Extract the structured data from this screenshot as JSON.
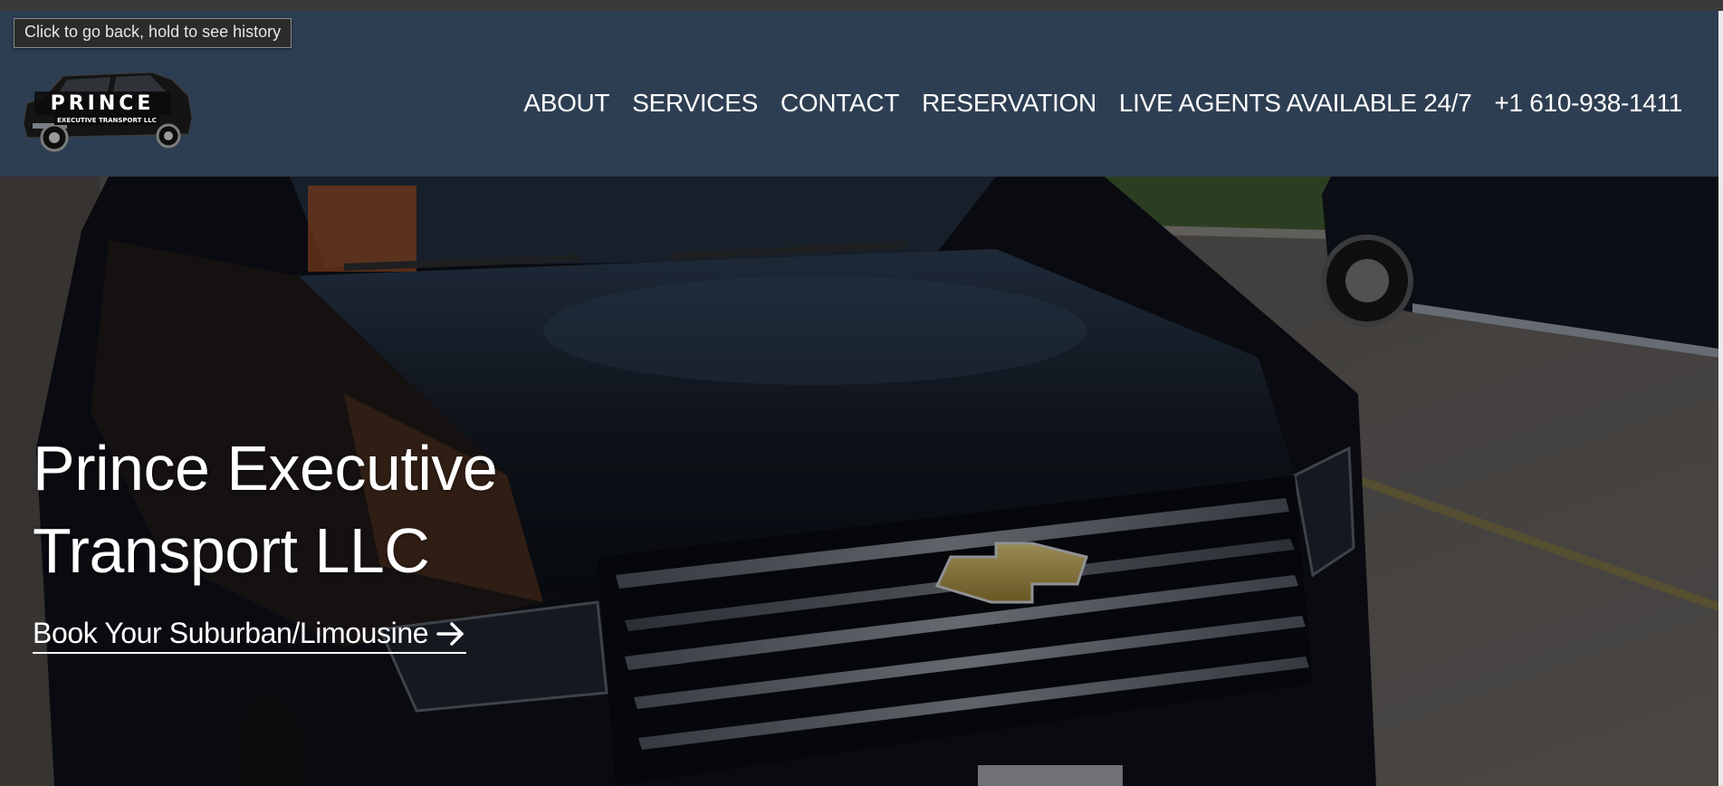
{
  "tooltip": {
    "text": "Click to go back, hold to see history"
  },
  "logo": {
    "brand": "PRINCE",
    "tagline": "EXECUTIVE TRANSPORT LLC"
  },
  "nav": {
    "items": [
      {
        "label": "ABOUT"
      },
      {
        "label": "SERVICES"
      },
      {
        "label": "CONTACT"
      },
      {
        "label": "RESERVATION"
      },
      {
        "label": "LIVE AGENTS AVAILABLE 24/7"
      },
      {
        "label": "+1 610-938-1411"
      }
    ]
  },
  "hero": {
    "title_line1": "Prince Executive",
    "title_line2": "Transport LLC",
    "cta_label": "Book Your Suburban/Limousine",
    "cta_icon": "arrow-right-icon"
  },
  "colors": {
    "header_bg": "#2e3e52",
    "text": "#ffffff",
    "tooltip_bg": "#2b2b2b"
  }
}
